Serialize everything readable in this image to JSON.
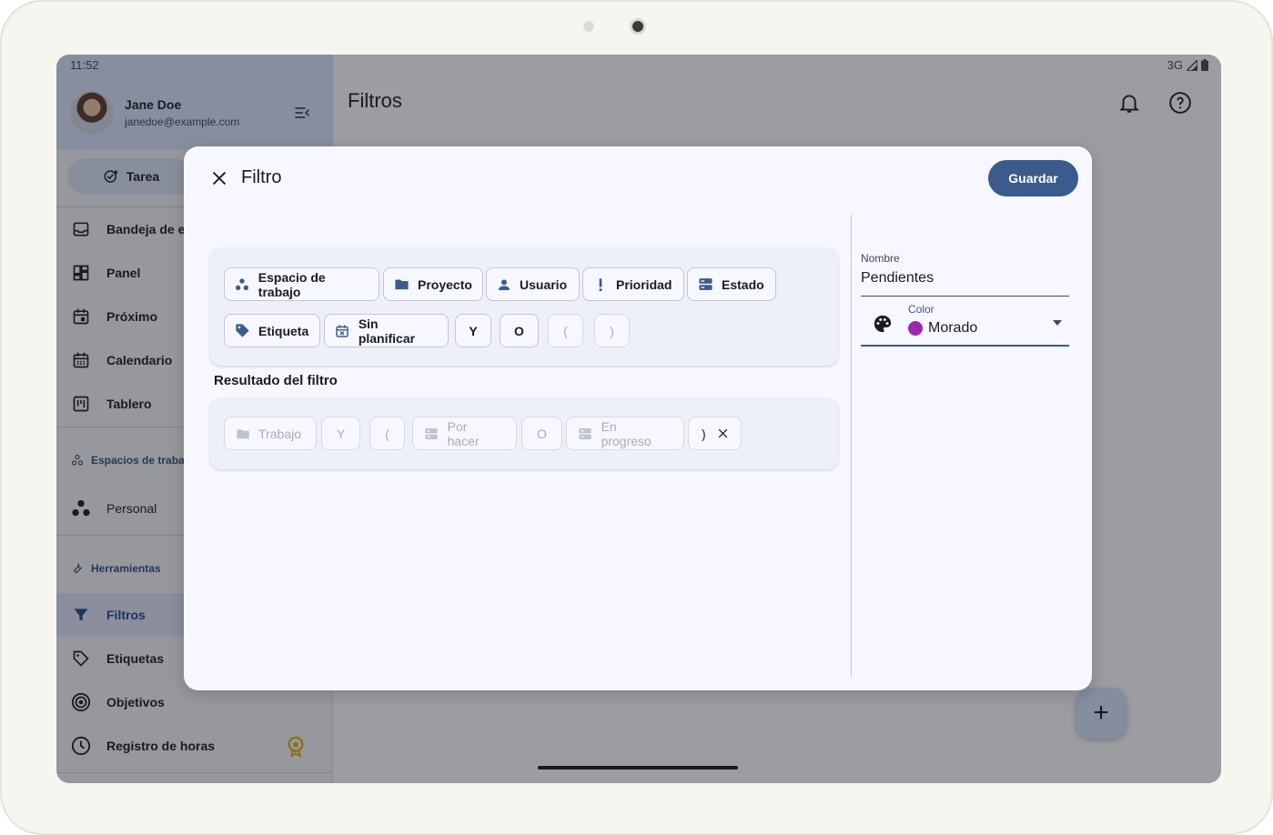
{
  "status_bar": {
    "time": "11:52",
    "network": "3G"
  },
  "drawer": {
    "user": {
      "name": "Jane Doe",
      "email": "janedoe@example.com"
    },
    "task_button": "Tarea",
    "items": [
      {
        "label": "Bandeja de e",
        "icon": "inbox-icon"
      },
      {
        "label": "Panel",
        "icon": "dashboard-icon"
      },
      {
        "label": "Próximo",
        "icon": "calendar-today-icon"
      },
      {
        "label": "Calendario",
        "icon": "calendar-month-icon"
      },
      {
        "label": "Tablero",
        "icon": "board-icon"
      }
    ],
    "workspaces_section": "Espacios de traba",
    "workspace_items": [
      {
        "label": "Personal",
        "icon": "workspace-icon"
      }
    ],
    "tools_section": "Herramientas",
    "tool_items": [
      {
        "label": "Filtros",
        "icon": "filter-icon",
        "active": true
      },
      {
        "label": "Etiquetas",
        "icon": "tag-icon"
      },
      {
        "label": "Objetivos",
        "icon": "target-icon"
      },
      {
        "label": "Registro de horas",
        "icon": "clock-icon"
      }
    ]
  },
  "topbar": {
    "title": "Filtros"
  },
  "dialog": {
    "title": "Filtro",
    "save_label": "Guardar",
    "palette_chips": [
      {
        "label": "Espacio de trabajo",
        "icon": "workspace-icon"
      },
      {
        "label": "Proyecto",
        "icon": "folder-icon"
      },
      {
        "label": "Usuario",
        "icon": "person-icon"
      },
      {
        "label": "Prioridad",
        "icon": "priority-icon"
      },
      {
        "label": "Estado",
        "icon": "status-icon"
      },
      {
        "label": "Etiqueta",
        "icon": "tag-icon"
      },
      {
        "label": "Sin planificar",
        "icon": "calendar-icon"
      },
      {
        "label": "Y"
      },
      {
        "label": "O"
      },
      {
        "label": "("
      },
      {
        "label": ")"
      }
    ],
    "result_label": "Resultado del filtro",
    "result_chips": [
      {
        "label": "Trabajo",
        "icon": "folder-icon"
      },
      {
        "label": "Y"
      },
      {
        "label": "("
      },
      {
        "label": "Por hacer",
        "icon": "status-icon"
      },
      {
        "label": "O"
      },
      {
        "label": "En progreso",
        "icon": "status-icon"
      },
      {
        "label": ")"
      }
    ],
    "name_field": {
      "label": "Nombre",
      "value": "Pendientes"
    },
    "color_field": {
      "label": "Color",
      "value": "Morado",
      "swatch": "#9c27b0"
    }
  },
  "colors": {
    "primary": "#3a5b8c",
    "surface": "#f7f8ff",
    "scrim": "rgba(24,26,32,0.42)"
  }
}
